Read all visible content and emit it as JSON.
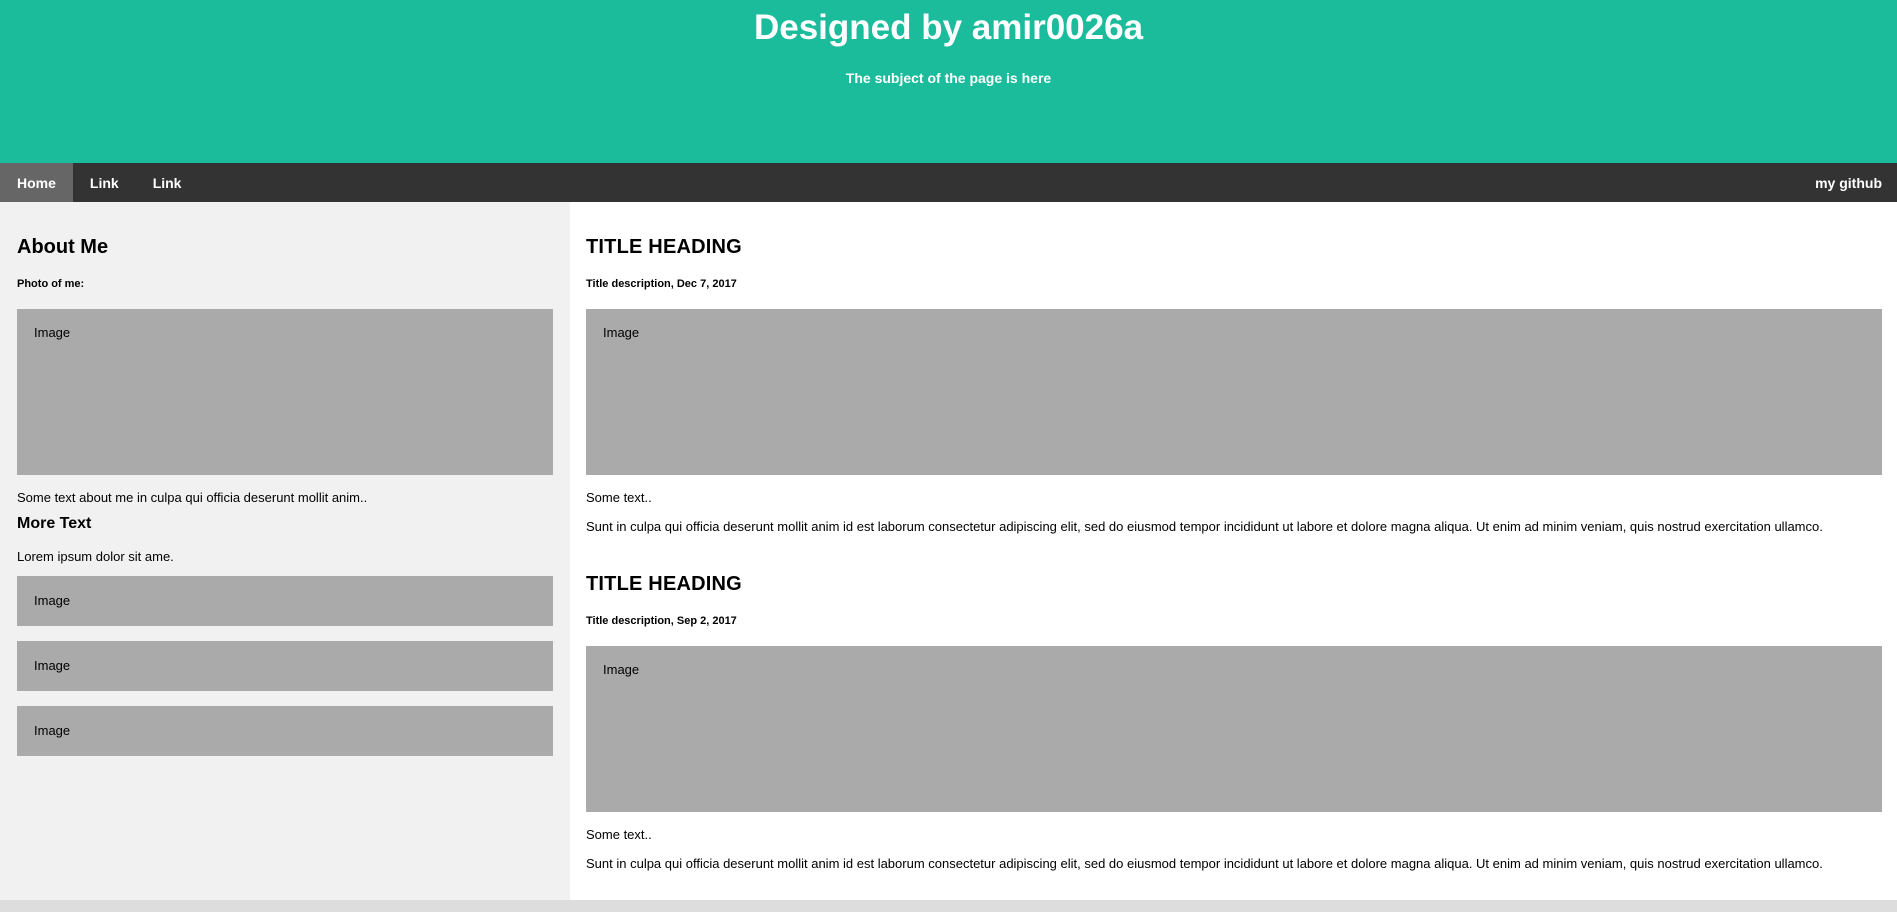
{
  "header": {
    "title": "Designed by amir0026a",
    "subtitle": "The subject of the page is here",
    "bg_color": "#1abc9c"
  },
  "navbar": {
    "items": [
      {
        "label": "Home",
        "active": true
      },
      {
        "label": "Link"
      },
      {
        "label": "Link"
      }
    ],
    "right_label": "my github"
  },
  "side": {
    "heading": "About Me",
    "photo_label": "Photo of me:",
    "photo_text": "Image",
    "about_text": "Some text about me in culpa qui officia deserunt mollit anim..",
    "more_heading": "More Text",
    "lorem": "Lorem ipsum dolor sit ame.",
    "images": [
      "Image",
      "Image",
      "Image"
    ]
  },
  "main": {
    "posts": [
      {
        "title": "TITLE HEADING",
        "description": "Title description, Dec 7, 2017",
        "image_text": "Image",
        "short_text": "Some text..",
        "body": "Sunt in culpa qui officia deserunt mollit anim id est laborum consectetur adipiscing elit, sed do eiusmod tempor incididunt ut labore et dolore magna aliqua. Ut enim ad minim veniam, quis nostrud exercitation ullamco."
      },
      {
        "title": "TITLE HEADING",
        "description": "Title description, Sep 2, 2017",
        "image_text": "Image",
        "short_text": "Some text..",
        "body": "Sunt in culpa qui officia deserunt mollit anim id est laborum consectetur adipiscing elit, sed do eiusmod tempor incididunt ut labore et dolore magna aliqua. Ut enim ad minim veniam, quis nostrud exercitation ullamco."
      }
    ]
  }
}
